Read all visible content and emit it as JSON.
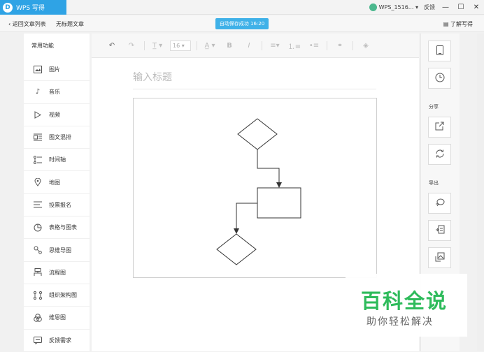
{
  "window": {
    "app_name": "WPS 写得",
    "logo_glyph": "D",
    "user_name": "WPS_1516...",
    "feedback_label": "反馈",
    "min_glyph": "—",
    "max_glyph": "☐",
    "close_glyph": "✕"
  },
  "navbar": {
    "back_label": "返回文章列表",
    "doc_title": "无标题文章",
    "save_status": "自动保存成功 16:20",
    "help_label": "了解写得"
  },
  "sidebar": {
    "heading": "常用功能",
    "items": [
      {
        "label": "图片",
        "icon": "image-icon"
      },
      {
        "label": "音乐",
        "icon": "music-icon"
      },
      {
        "label": "视频",
        "icon": "video-icon"
      },
      {
        "label": "图文混排",
        "icon": "image-text-icon"
      },
      {
        "label": "时间轴",
        "icon": "timeline-icon"
      },
      {
        "label": "地图",
        "icon": "map-pin-icon"
      },
      {
        "label": "投票报名",
        "icon": "vote-icon"
      },
      {
        "label": "表格与图表",
        "icon": "chart-icon"
      },
      {
        "label": "思维导图",
        "icon": "mindmap-icon"
      },
      {
        "label": "流程图",
        "icon": "flowchart-icon"
      },
      {
        "label": "组织架构图",
        "icon": "org-chart-icon"
      },
      {
        "label": "维恩图",
        "icon": "venn-icon"
      },
      {
        "label": "反馈需求",
        "icon": "feedback-icon"
      }
    ]
  },
  "toolbar": {
    "font_size_value": "16"
  },
  "editor": {
    "title_placeholder": "输入标题"
  },
  "right_panel": {
    "share_label": "分享",
    "export_label": "导出"
  },
  "watermark": {
    "title": "百科全说",
    "subtitle": "助你轻松解决"
  },
  "colors": {
    "accent": "#2fa3e5",
    "save_pill": "#3fb1e8",
    "watermark_green": "#2ebb5b"
  }
}
